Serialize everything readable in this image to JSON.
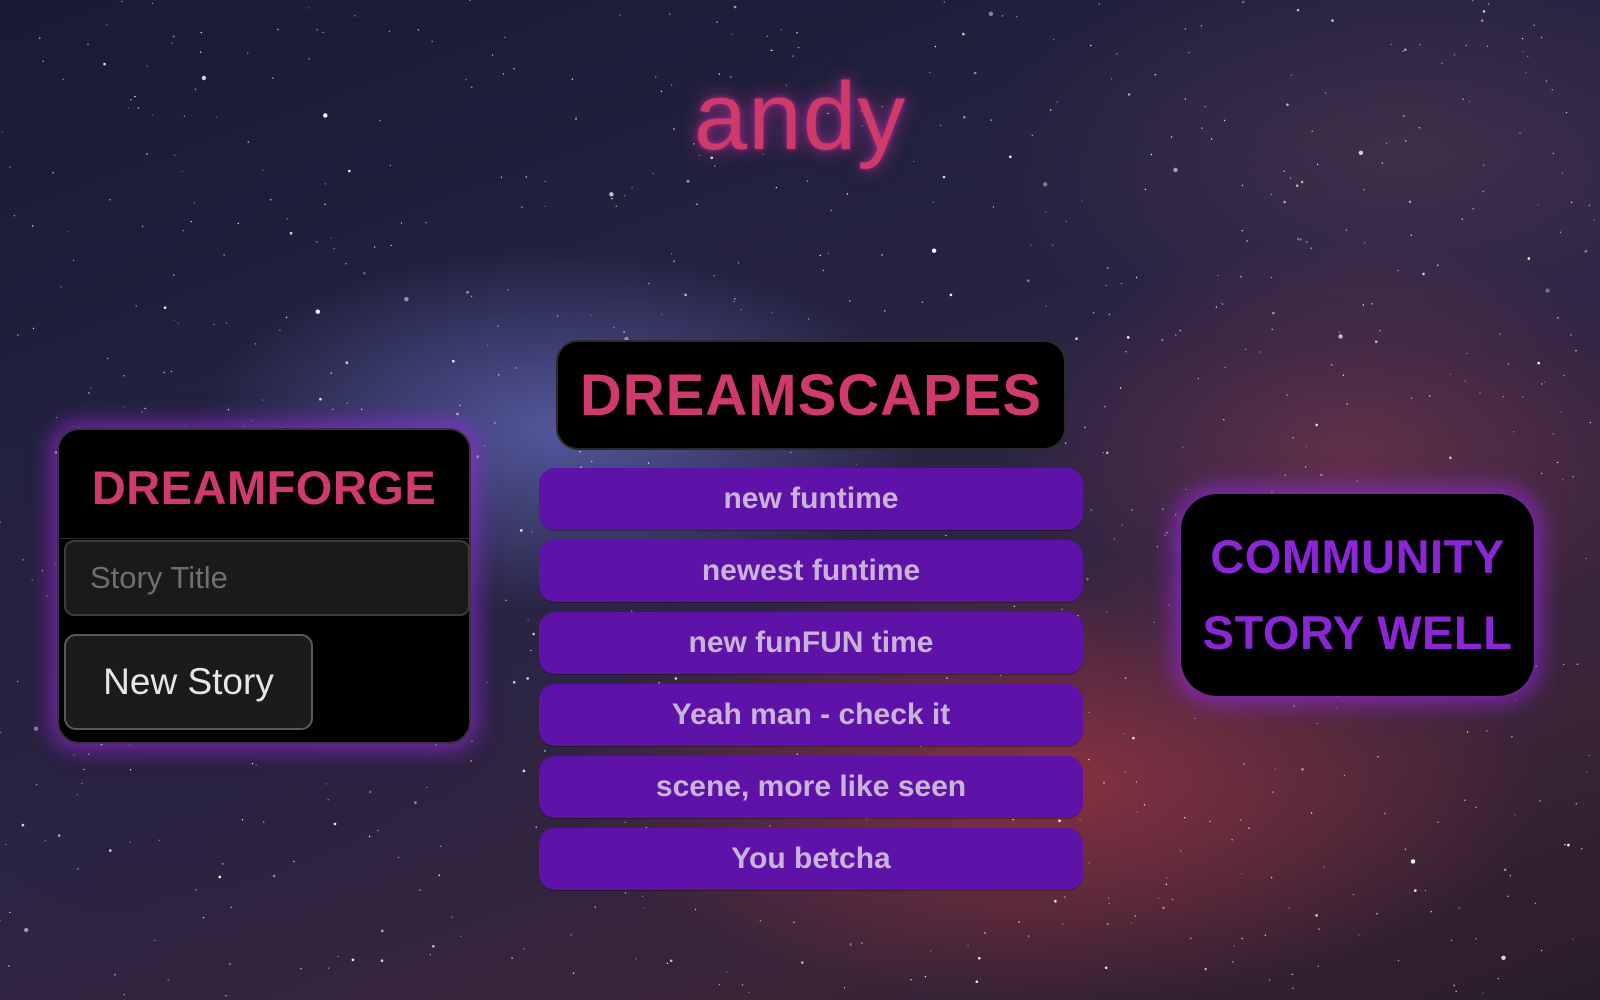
{
  "header": {
    "user_name": "andy"
  },
  "dreamforge": {
    "title": "DREAMFORGE",
    "story_title_placeholder": "Story Title",
    "story_title_value": "",
    "new_story_label": "New Story"
  },
  "dreamscapes": {
    "title": "DREAMSCAPES",
    "items": [
      {
        "label": "new funtime"
      },
      {
        "label": "newest funtime"
      },
      {
        "label": "new funFUN time"
      },
      {
        "label": "Yeah man - check it"
      },
      {
        "label": "scene, more like seen"
      },
      {
        "label": "You betcha"
      }
    ]
  },
  "community_well": {
    "line1": "COMMUNITY",
    "line2": "STORY WELL"
  },
  "colors": {
    "title_pink": "#cf3a6a",
    "item_purple": "#5e12a8",
    "well_text_purple": "#8a26d6",
    "glow_purple": "#9628dc"
  }
}
